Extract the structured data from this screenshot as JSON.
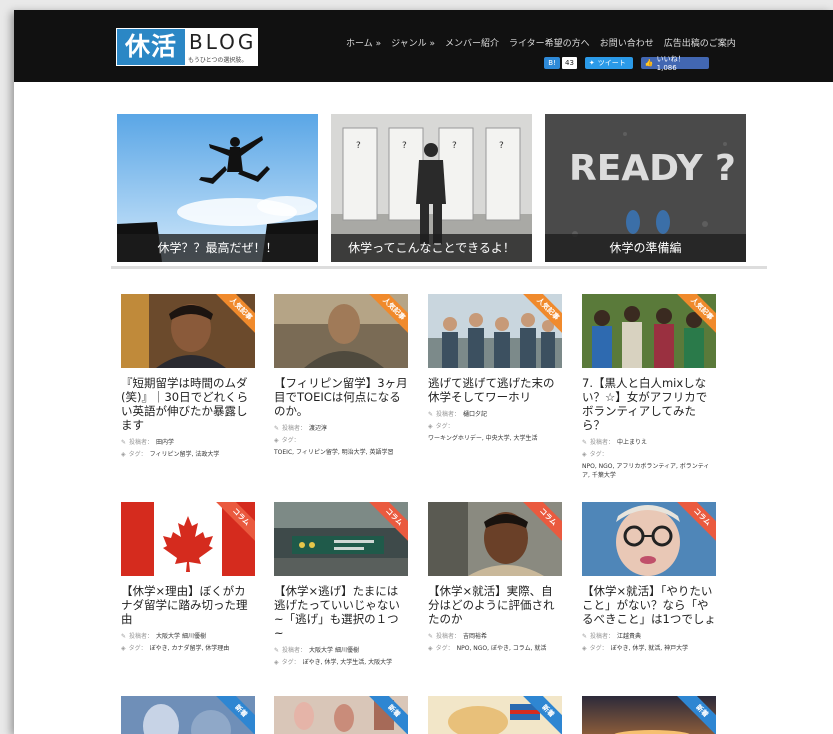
{
  "logo": {
    "kanji": "休活",
    "word": "BLOG",
    "tagline": "もうひとつの選択肢。"
  },
  "nav": [
    "ホーム »",
    "ジャンル »",
    "メンバー紹介",
    "ライター希望の方へ",
    "お問い合わせ",
    "広告出稿のご案内"
  ],
  "social": {
    "hatena_count": "43",
    "tweet": "ツイート",
    "like": "いいね！ 1,086"
  },
  "featured": [
    {
      "caption": "休学？？最高だぜ！！"
    },
    {
      "caption": "休学ってこんなことできるよ！"
    },
    {
      "caption": "休学の準備編",
      "sign": "READY ?"
    }
  ],
  "labels": {
    "author": "投稿者：",
    "tags": "タグ："
  },
  "articles": [
    {
      "ribbon": "人気記事",
      "title": "『短期留学は時間のムダ(笑)』｜30日でどれくらい英語が伸びたか暴露します",
      "author": "田内学",
      "tags": "フィリピン留学, 法政大学"
    },
    {
      "ribbon": "人気記事",
      "title": "【フィリピン留学】3ヶ月目でTOEICは何点になるのか。",
      "author": "渡辺淳",
      "tags": "TOEIC, フィリピン留学, 明治大学, 英語学習"
    },
    {
      "ribbon": "人気記事",
      "title": "逃げて逃げて逃げた末の休学そしてワーホリ",
      "author": "樋口夕記",
      "tags": "ワーキングホリデー, 中央大学, 大学生活"
    },
    {
      "ribbon": "人気記事",
      "title": "7.【黒人と白人mixしない？☆】女がアフリカでボランティアしてみたら？",
      "author": "中上まりえ",
      "tags": "NPO, NGO, アフリカボランティア, ボランティア, 千葉大学"
    },
    {
      "ribbon": "コラム",
      "title": "【休学×理由】ぼくがカナダ留学に踏み切った理由",
      "author": "大阪大学 細川優樹",
      "tags": "ぼやき, カナダ留学, 休学理由"
    },
    {
      "ribbon": "コラム",
      "title": "【休学×逃げ】たまには逃げたっていいじゃない~「逃げ」も選択の１つ~",
      "author": "大阪大学 細川優樹",
      "tags": "ぼやき, 休学, 大学生活, 大阪大学"
    },
    {
      "ribbon": "コラム",
      "title": "【休学×就活】実際、自分はどのように評価されたのか",
      "author": "吉岡裕希",
      "tags": "NPO, NGO, ぼやき, コラム, 就活"
    },
    {
      "ribbon": "コラム",
      "title": "【休学×就活】「やりたいこと」がない？なら「やるべきこと」は1つでしょ",
      "author": "江越貴典",
      "tags": "ぼやき, 休学, 就活, 神戸大学"
    },
    {
      "ribbon": "新着"
    },
    {
      "ribbon": "新着"
    },
    {
      "ribbon": "新着"
    },
    {
      "ribbon": "新着"
    }
  ]
}
